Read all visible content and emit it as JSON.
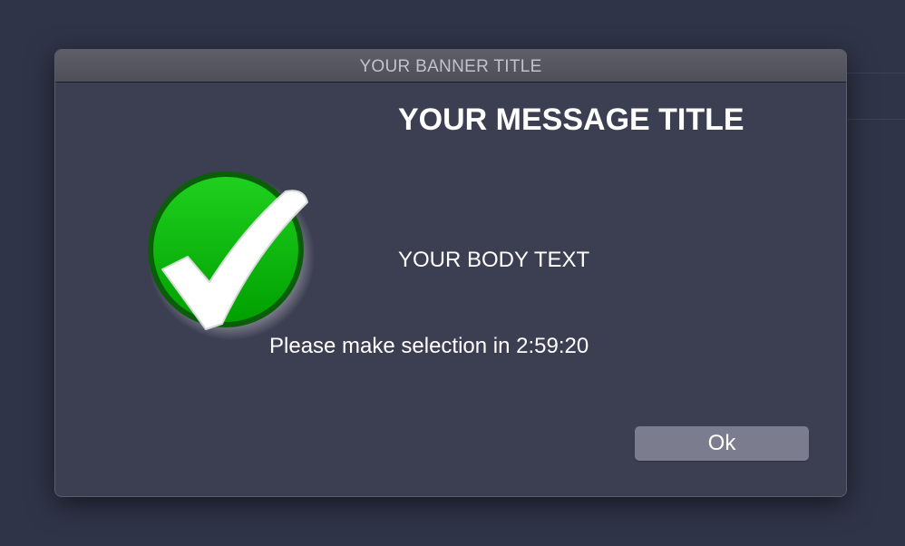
{
  "dialog": {
    "banner_title": "YOUR BANNER TITLE",
    "message_title": "YOUR MESSAGE TITLE",
    "body_text": "YOUR BODY TEXT",
    "countdown_text": "Please make selection in 2:59:20",
    "icon": "green-checkmark-icon",
    "ok_label": "Ok"
  },
  "colors": {
    "background": "#303448",
    "dialog_background": "#3c3e52",
    "titlebar": "#55565f",
    "button": "#7b7d8e",
    "icon_green": "#00b800"
  }
}
